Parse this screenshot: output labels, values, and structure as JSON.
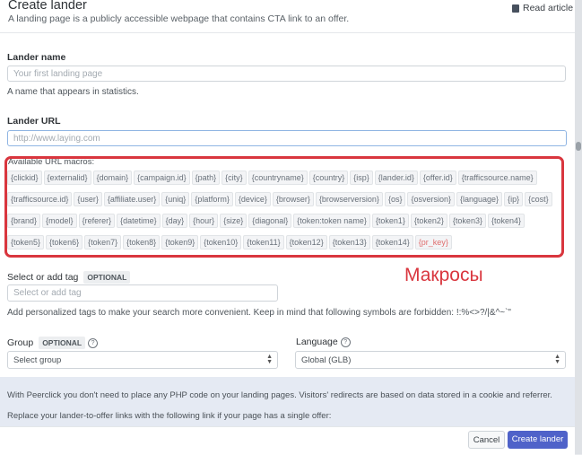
{
  "header": {
    "title": "Create lander",
    "subtitle": "A landing page is a publicly accessible webpage that contains CTA link to an offer.",
    "read_article": "Read article"
  },
  "lander_name": {
    "label": "Lander name",
    "placeholder": "Your first landing page",
    "hint": "A name that appears in statistics."
  },
  "lander_url": {
    "label": "Lander URL",
    "placeholder": "http://www.laying.com"
  },
  "macros": {
    "title": "Available URL macros:",
    "items": [
      "{clickid}",
      "{externalid}",
      "{domain}",
      "{campaign.id}",
      "{path}",
      "{city}",
      "{countryname}",
      "{country}",
      "{isp}",
      "{lander.id}",
      "{offer.id}",
      "{trafficsource.name}",
      "{trafficsource.id}",
      "{user}",
      "{affiliate.user}",
      "{uniq}",
      "{platform}",
      "{device}",
      "{browser}",
      "{browserversion}",
      "{os}",
      "{osversion}",
      "{language}",
      "{ip}",
      "{cost}",
      "{brand}",
      "{model}",
      "{referer}",
      "{datetime}",
      "{day}",
      "{hour}",
      "{size}",
      "{diagonal}",
      "{token:token name}",
      "{token1}",
      "{token2}",
      "{token3}",
      "{token4}",
      "{token5}",
      "{token6}",
      "{token7}",
      "{token8}",
      "{token9}",
      "{token10}",
      "{token11}",
      "{token12}",
      "{token13}",
      "{token14}",
      "{pr_key}"
    ],
    "annotation": "Макросы"
  },
  "tags": {
    "label": "Select or add tag",
    "optional": "OPTIONAL",
    "placeholder": "Select or add tag",
    "hint": "Add personalized tags to make your search more convenient. Keep in mind that following symbols are forbidden: !:%<>?/|&^~`\""
  },
  "group": {
    "label": "Group",
    "optional": "OPTIONAL",
    "value": "Select group"
  },
  "language": {
    "label": "Language",
    "value": "Global (GLB)"
  },
  "info": {
    "line1": "With Peerclick you don't need to place any PHP code on your landing pages. Visitors' redirects are based on data stored in a cookie and referrer.",
    "line2": "Replace your lander-to-offer links with the following link if your page has a single offer:"
  },
  "footer": {
    "cancel": "Cancel",
    "create": "Create lander"
  }
}
